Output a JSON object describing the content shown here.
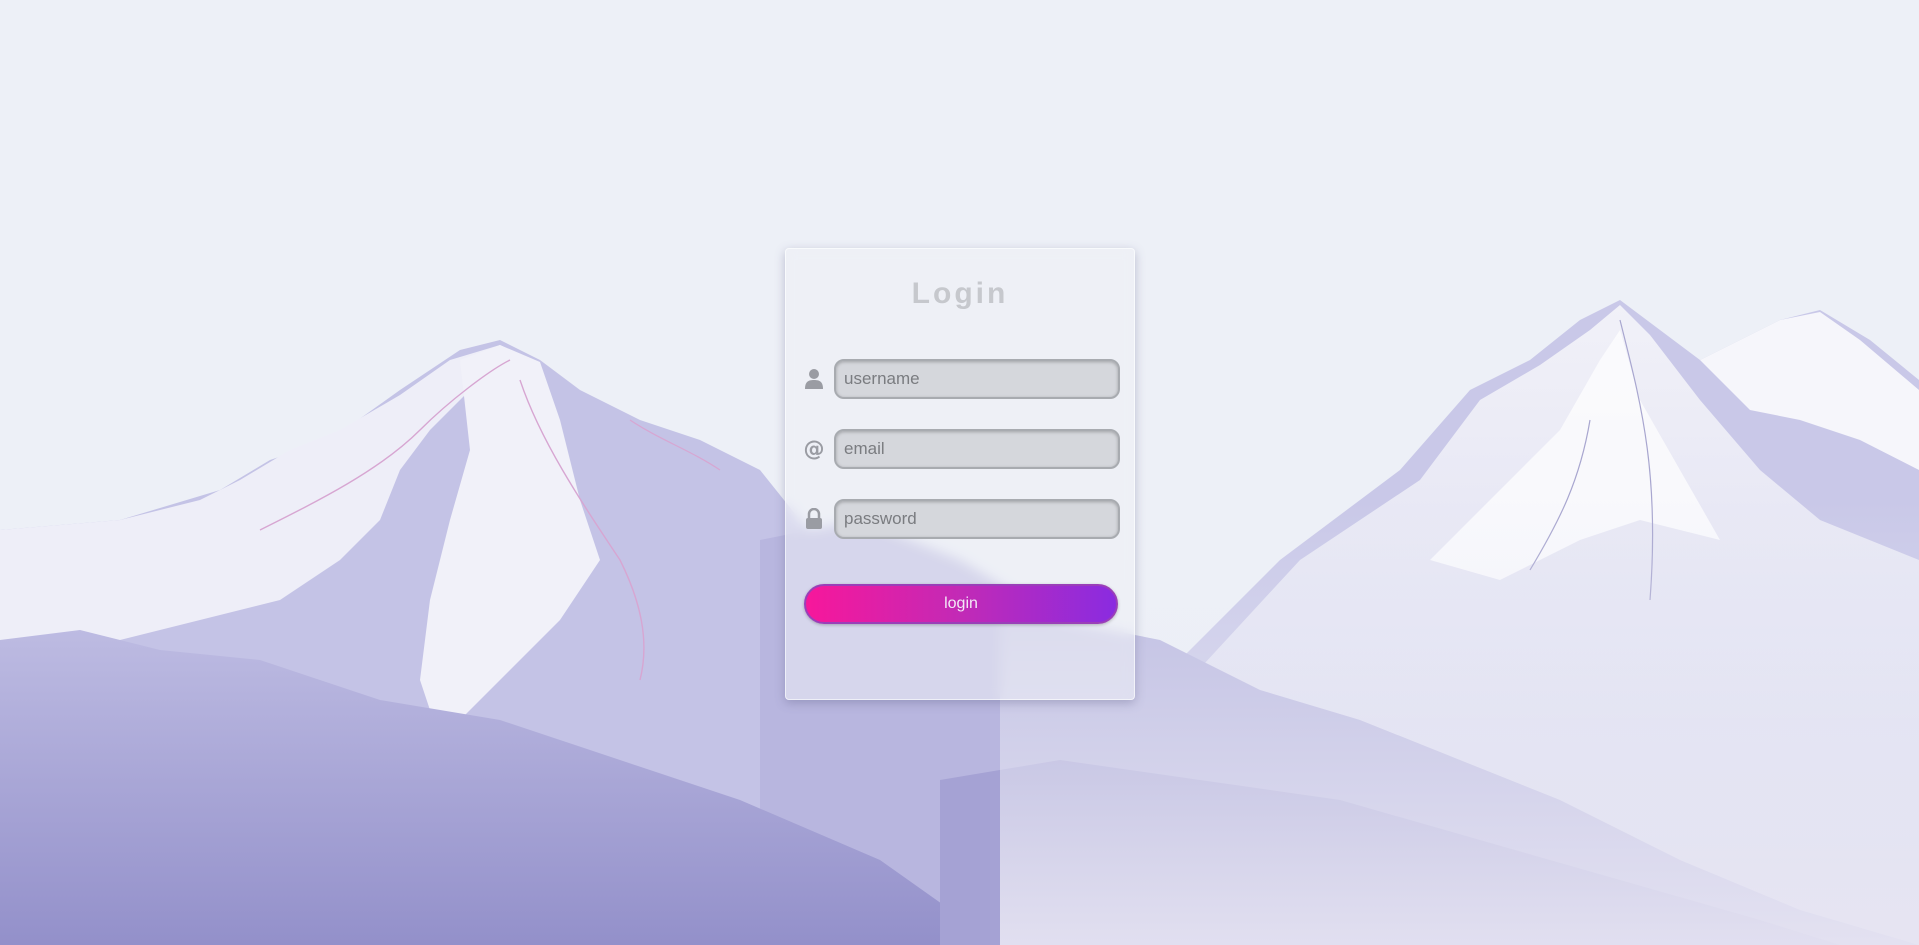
{
  "login": {
    "title": "Login",
    "username_placeholder": "username",
    "email_placeholder": "email",
    "password_placeholder": "password",
    "button_label": "login"
  },
  "icons": {
    "username": "user-icon",
    "email": "at-sign-icon",
    "password": "lock-icon"
  },
  "colors": {
    "background": "#edf0f7",
    "mountain_shade": "#9c98cc",
    "button_start": "#f7179b",
    "button_end": "#8a2be0",
    "title_text": "#c6c8cd"
  }
}
